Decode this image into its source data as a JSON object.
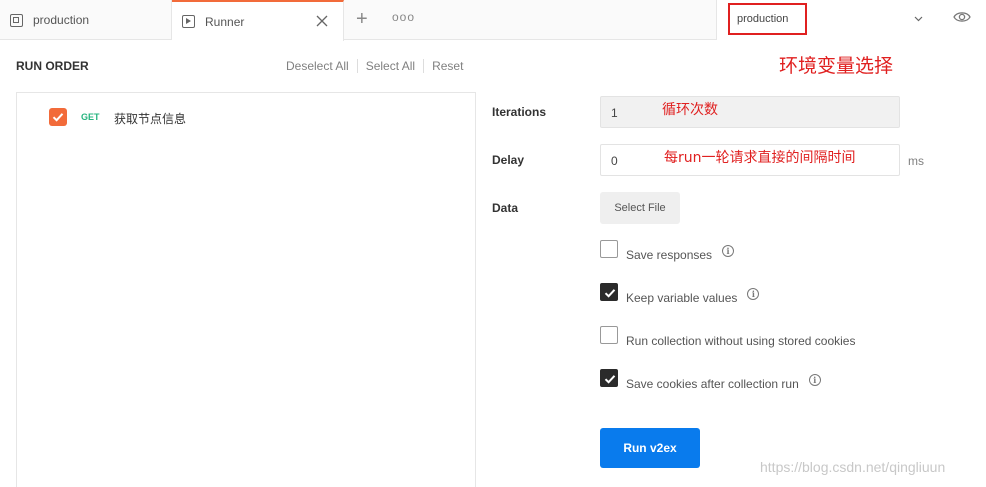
{
  "tabs": [
    {
      "label": "production"
    },
    {
      "label": "Runner"
    }
  ],
  "environment": {
    "selected": "production"
  },
  "left": {
    "heading": "RUN ORDER",
    "actions": [
      "Deselect All",
      "Select All",
      "Reset"
    ],
    "requests": [
      {
        "method": "GET",
        "name": "获取节点信息",
        "checked": true
      }
    ]
  },
  "form": {
    "iterations_label": "Iterations",
    "iterations_value": "1",
    "delay_label": "Delay",
    "delay_value": "0",
    "delay_unit": "ms",
    "data_label": "Data",
    "select_file_label": "Select File",
    "options": [
      {
        "label": "Save responses",
        "checked": false,
        "info": true
      },
      {
        "label": "Keep variable values",
        "checked": true,
        "info": true
      },
      {
        "label": "Run collection without using stored cookies",
        "checked": false,
        "info": false
      },
      {
        "label": "Save cookies after collection run",
        "checked": true,
        "info": true
      }
    ],
    "run_button": "Run v2ex"
  },
  "annotations": {
    "environment": "环境变量选择",
    "iterations": "循环次数",
    "delay": "每run一轮请求直接的间隔时间"
  },
  "watermark": "https://blog.csdn.net/qingliuun",
  "colors": {
    "accent_orange": "#f26b3a",
    "primary_blue": "#097bed",
    "get_green": "#26b47f",
    "annotation_red": "#e02020"
  }
}
